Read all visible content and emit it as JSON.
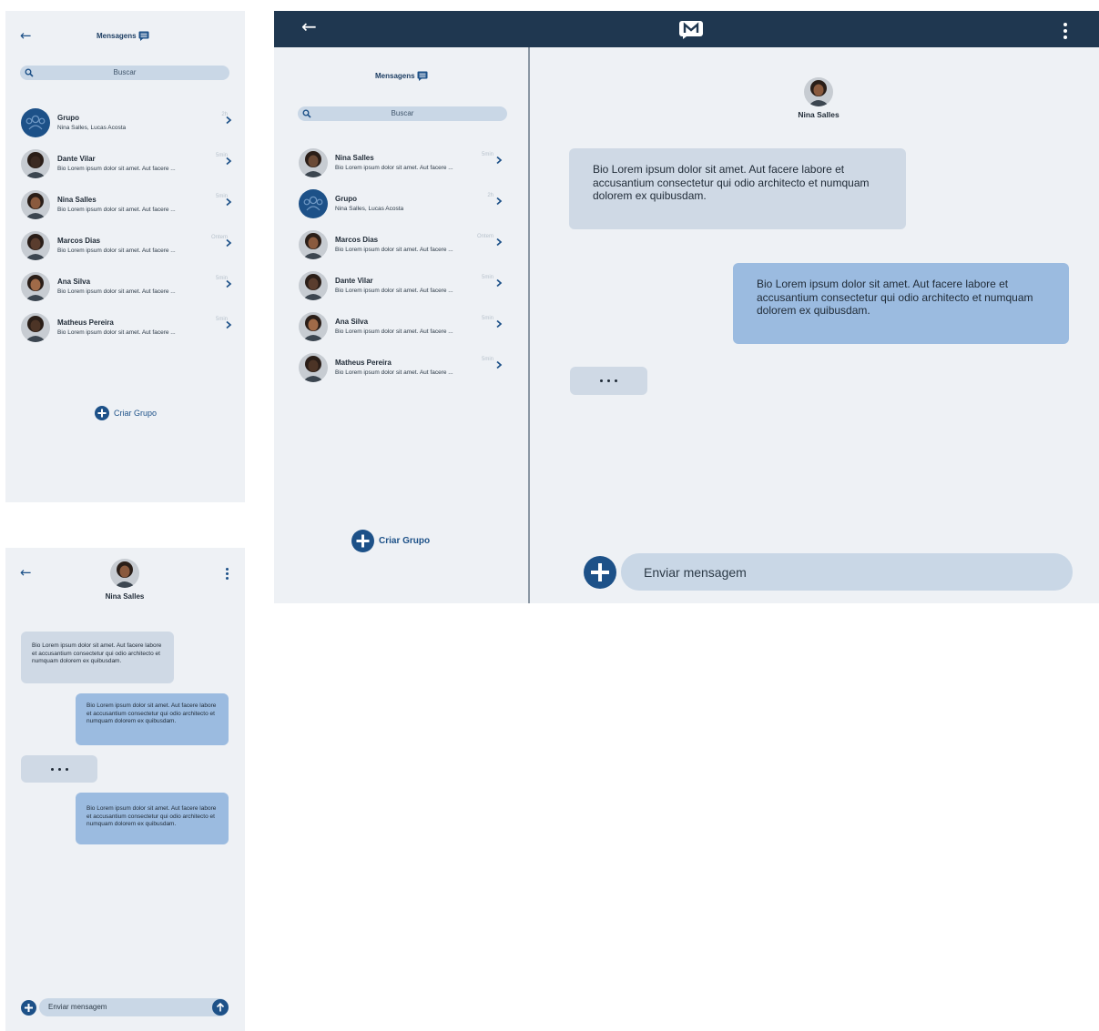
{
  "colors": {
    "primary": "#1d5188",
    "header": "#1f3750",
    "panel_bg": "#eef1f5",
    "search_bg": "#c9d7e6",
    "incoming_bubble": "#cfd9e5",
    "outgoing_bubble": "#9bbbe0"
  },
  "list_screen": {
    "title": "Mensagens",
    "search_placeholder": "Buscar",
    "conversations": [
      {
        "name": "Grupo",
        "snippet": "Nina Salles, Lucas Acosta",
        "time": "2h",
        "avatar": "group-icon"
      },
      {
        "name": "Dante Vilar",
        "snippet": "Bio Lorem ipsum dolor sit amet. Aut facere ...",
        "time": "5min",
        "avatar": "person-photo"
      },
      {
        "name": "Nina Salles",
        "snippet": "Bio Lorem ipsum dolor sit amet. Aut facere ...",
        "time": "5min",
        "avatar": "person-photo"
      },
      {
        "name": "Marcos Dias",
        "snippet": "Bio Lorem ipsum dolor sit amet. Aut facere ...",
        "time": "Ontem",
        "avatar": "person-photo"
      },
      {
        "name": "Ana Silva",
        "snippet": "Bio Lorem ipsum dolor sit amet. Aut facere ...",
        "time": "5min",
        "avatar": "person-photo"
      },
      {
        "name": "Matheus Pereira",
        "snippet": "Bio Lorem ipsum dolor sit amet. Aut facere ...",
        "time": "5min",
        "avatar": "person-photo"
      }
    ],
    "create_group": "Criar Grupo"
  },
  "chat_screen": {
    "contact_name": "Nina Salles",
    "messages": [
      {
        "direction": "in",
        "text": "Bio Lorem ipsum dolor sit amet. Aut facere labore et accusantium consectetur qui odio architecto et numquam dolorem ex quibusdam."
      },
      {
        "direction": "out",
        "text": "Bio Lorem ipsum dolor sit amet. Aut facere labore et accusantium consectetur qui odio architecto et numquam dolorem ex quibusdam."
      },
      {
        "direction": "typing",
        "text": ""
      },
      {
        "direction": "out",
        "text": "Bio Lorem ipsum dolor sit amet. Aut facere labore et accusantium consectetur qui odio architecto et numquam dolorem ex quibusdam."
      }
    ],
    "composer_placeholder": "Enviar mensagem"
  },
  "desktop": {
    "sidebar": {
      "title": "Mensagens",
      "search_placeholder": "Buscar",
      "conversations": [
        {
          "name": "Nina Salles",
          "snippet": "Bio Lorem ipsum dolor sit amet. Aut facere ...",
          "time": "5min",
          "avatar": "person-photo"
        },
        {
          "name": "Grupo",
          "snippet": "Nina Salles, Lucas Acosta",
          "time": "2h",
          "avatar": "group-icon"
        },
        {
          "name": "Marcos Dias",
          "snippet": "Bio Lorem ipsum dolor sit amet. Aut facere ...",
          "time": "Ontem",
          "avatar": "person-photo"
        },
        {
          "name": "Dante Vilar",
          "snippet": "Bio Lorem ipsum dolor sit amet. Aut facere ...",
          "time": "5min",
          "avatar": "person-photo"
        },
        {
          "name": "Ana Silva",
          "snippet": "Bio Lorem ipsum dolor sit amet. Aut facere ...",
          "time": "5min",
          "avatar": "person-photo"
        },
        {
          "name": "Matheus Pereira",
          "snippet": "Bio Lorem ipsum dolor sit amet. Aut facere ...",
          "time": "5min",
          "avatar": "person-photo"
        }
      ],
      "create_group": "Criar Grupo"
    },
    "chat": {
      "contact_name": "Nina Salles",
      "messages": [
        {
          "direction": "in",
          "text": "Bio Lorem ipsum dolor sit amet. Aut facere labore et accusantium consectetur qui odio architecto et numquam dolorem ex quibusdam."
        },
        {
          "direction": "out",
          "text": "Bio Lorem ipsum dolor sit amet. Aut facere labore et accusantium consectetur qui odio architecto et numquam dolorem ex quibusdam."
        },
        {
          "direction": "typing",
          "text": ""
        }
      ],
      "composer_placeholder": "Enviar mensagem"
    }
  }
}
